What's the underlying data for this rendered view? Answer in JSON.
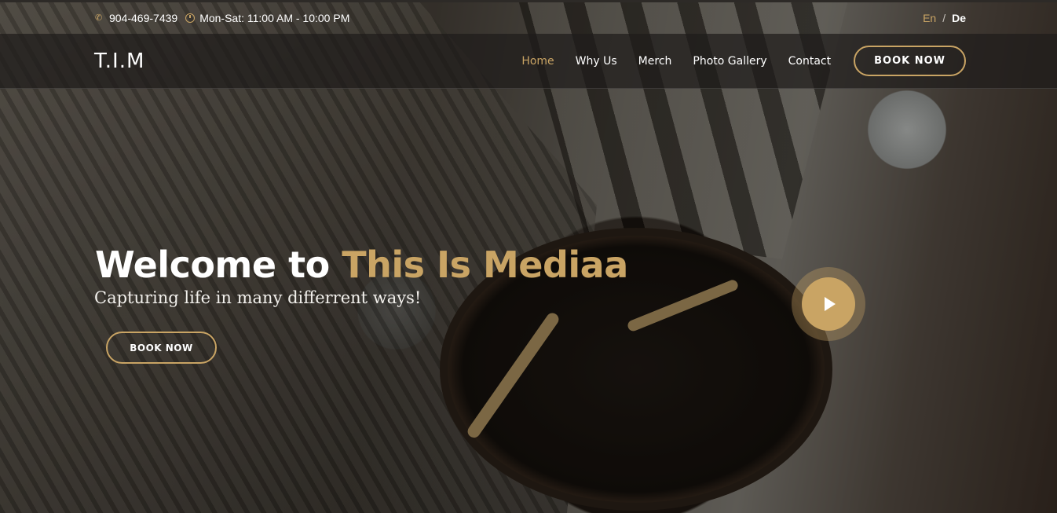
{
  "topbar": {
    "phone": "904-469-7439",
    "hours": "Mon-Sat: 11:00 AM - 10:00 PM",
    "phone_icon": "phone-icon",
    "hours_icon": "clock-icon",
    "lang_en": "En",
    "lang_sep": "/",
    "lang_de": "De"
  },
  "nav": {
    "logo": "T.I.M",
    "items": [
      {
        "label": "Home",
        "active": true
      },
      {
        "label": "Why Us"
      },
      {
        "label": "Merch"
      },
      {
        "label": "Photo Gallery"
      },
      {
        "label": "Contact"
      }
    ],
    "book_label": "BOOK NOW"
  },
  "hero": {
    "title_prefix": "Welcome to",
    "title_brand": "This Is Mediaa",
    "subtitle": "Capturing life in many differrent ways!",
    "book_label": "BOOK NOW",
    "play_icon": "play-icon"
  },
  "colors": {
    "accent": "#c9a464",
    "text": "#ffffff"
  }
}
